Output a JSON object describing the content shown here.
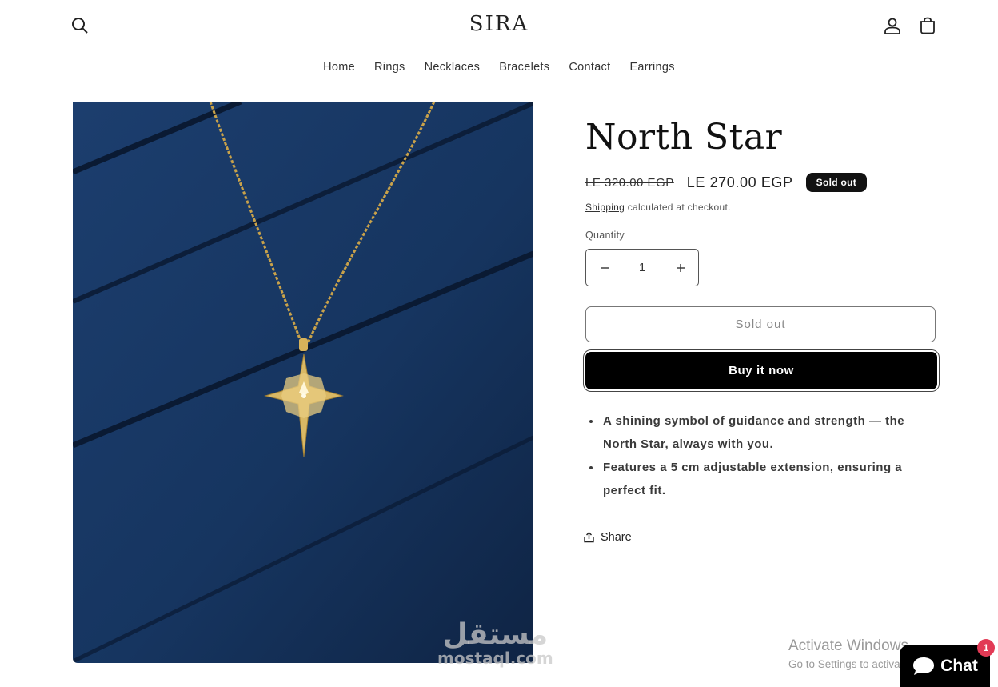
{
  "header": {
    "logo": "SIRA",
    "nav": [
      "Home",
      "Rings",
      "Necklaces",
      "Bracelets",
      "Contact",
      "Earrings"
    ],
    "icons": [
      "search-icon",
      "account-icon",
      "cart-icon"
    ]
  },
  "product": {
    "title": "North Star",
    "price_old": "LE 320.00 EGP",
    "price_new": "LE 270.00 EGP",
    "badge": "Sold out",
    "shipping_link": "Shipping",
    "shipping_text": " calculated at checkout.",
    "quantity_label": "Quantity",
    "quantity_value": "1",
    "sold_out_button": "Sold out",
    "buy_now_button": "Buy it now",
    "description": [
      "A shining symbol of guidance and strength — the North Star, always with you.",
      "Features a 5 cm adjustable extension, ensuring a perfect fit."
    ],
    "share_label": "Share"
  },
  "watermark": {
    "arabic": "مستقل",
    "latin": "mostaql.com"
  },
  "os_overlay": {
    "activate_title": "Activate Windows",
    "activate_sub": "Go to Settings to activate Windows."
  },
  "chat": {
    "label": "Chat",
    "badge": "1"
  },
  "colors": {
    "primary": "#000000",
    "badge": "#121212",
    "chat_badge": "#e23a55",
    "image_bg": "#16345e"
  }
}
